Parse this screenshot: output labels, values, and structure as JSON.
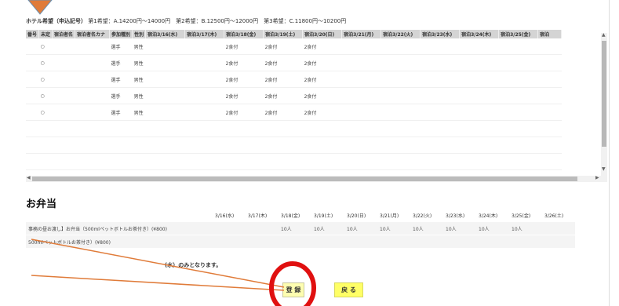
{
  "hotel_pref": {
    "label": "ホテル希望（申込記号）",
    "text": "第1希望：A.14200円〜14000円　第2希望：B.12500円〜12000円　第3希望：C.11800円〜10200円"
  },
  "lodging_table": {
    "headers": [
      "番号",
      "未定",
      "宿泊者名",
      "宿泊者名カナ",
      "参加種別",
      "性別",
      "宿泊3/16(水)",
      "宿泊3/17(木)",
      "宿泊3/18(金)",
      "宿泊3/19(土)",
      "宿泊3/20(日)",
      "宿泊3/21(月)",
      "宿泊3/22(火)",
      "宿泊3/23(水)",
      "宿泊3/24(木)",
      "宿泊3/25(金)",
      "宿泊"
    ],
    "rows": [
      [
        "",
        "○",
        "",
        "",
        "選手",
        "男性",
        "",
        "",
        "2食付",
        "2食付",
        "2食付",
        "",
        "",
        "",
        "",
        "",
        ""
      ],
      [
        "",
        "○",
        "",
        "",
        "選手",
        "男性",
        "",
        "",
        "2食付",
        "2食付",
        "2食付",
        "",
        "",
        "",
        "",
        "",
        ""
      ],
      [
        "",
        "○",
        "",
        "",
        "選手",
        "男性",
        "",
        "",
        "2食付",
        "2食付",
        "2食付",
        "",
        "",
        "",
        "",
        "",
        ""
      ],
      [
        "",
        "○",
        "",
        "",
        "選手",
        "男性",
        "",
        "",
        "2食付",
        "2食付",
        "2食付",
        "",
        "",
        "",
        "",
        "",
        ""
      ],
      [
        "",
        "○",
        "",
        "",
        "選手",
        "男性",
        "",
        "",
        "2食付",
        "2食付",
        "2食付",
        "",
        "",
        "",
        "",
        "",
        ""
      ]
    ]
  },
  "bento": {
    "title": "お弁当",
    "date_headers": [
      "3/16(水)",
      "3/17(木)",
      "3/18(金)",
      "3/19(土)",
      "3/20(日)",
      "3/21(月)",
      "3/22(火)",
      "3/23(水)",
      "3/24(木)",
      "3/25(金)",
      "3/26(土)"
    ],
    "rows": [
      {
        "item": "事務の昼お渡し】お弁当（500mlペットボトルお茶付き）(¥800)",
        "values": [
          "",
          "",
          "10人",
          "10人",
          "10人",
          "10人",
          "10人",
          "10人",
          "10人",
          "10人",
          ""
        ]
      },
      {
        "item": "500mlペットボトルお茶付き）(¥800)",
        "values": [
          "",
          "",
          "",
          "",
          "",
          "",
          "",
          "",
          "",
          "",
          ""
        ]
      }
    ],
    "note": "(水）のみとなります。"
  },
  "buttons": {
    "register": "登 録",
    "back": "戻 る"
  },
  "colors": {
    "annotation": "#e07b39",
    "highlight": "#e01010",
    "button_yellow": "#ffff66"
  }
}
